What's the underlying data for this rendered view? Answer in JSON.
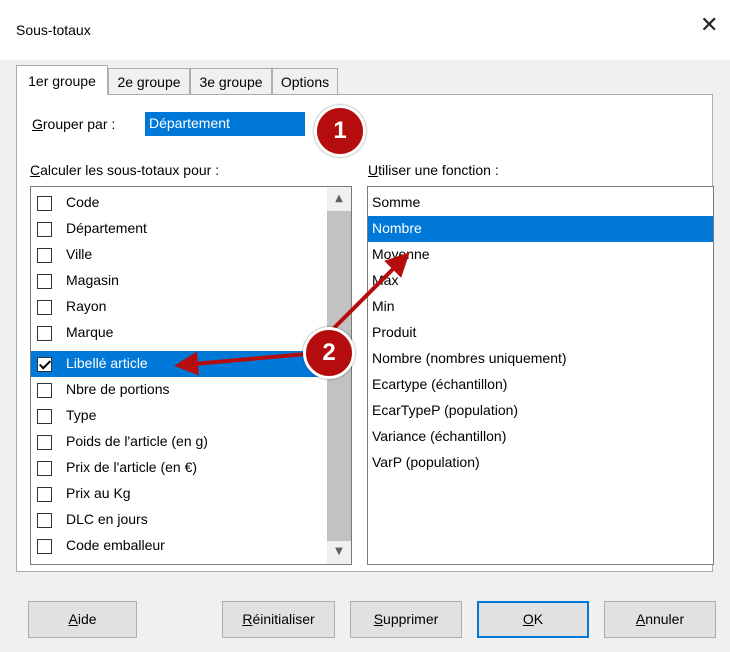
{
  "dialog": {
    "title": "Sous-totaux",
    "close_glyph": "✕"
  },
  "tabs": [
    {
      "label": "1er groupe",
      "active": true
    },
    {
      "label": "2e groupe",
      "active": false
    },
    {
      "label": "3e groupe",
      "active": false
    },
    {
      "label": "Options",
      "active": false
    }
  ],
  "group_by": {
    "label_key": "G",
    "label_rest": "rouper par :",
    "selected_value": "Département"
  },
  "subtotals_for": {
    "label_key": "C",
    "label_rest": "alculer les sous-totaux pour :",
    "items": [
      {
        "label": "Code",
        "checked": false,
        "selected": false
      },
      {
        "label": "Département",
        "checked": false,
        "selected": false
      },
      {
        "label": "Ville",
        "checked": false,
        "selected": false
      },
      {
        "label": "Magasin",
        "checked": false,
        "selected": false
      },
      {
        "label": "Rayon",
        "checked": false,
        "selected": false
      },
      {
        "label": "Marque",
        "checked": false,
        "selected": false
      },
      {
        "label": "Libellé article",
        "checked": true,
        "selected": true
      },
      {
        "label": " Nbre de portions",
        "checked": false,
        "selected": false
      },
      {
        "label": "Type",
        "checked": false,
        "selected": false
      },
      {
        "label": "Poids de l'article (en g)",
        "checked": false,
        "selected": false
      },
      {
        "label": "Prix de l'article (en €)",
        "checked": false,
        "selected": false
      },
      {
        "label": "Prix au Kg",
        "checked": false,
        "selected": false
      },
      {
        "label": "DLC en jours",
        "checked": false,
        "selected": false
      },
      {
        "label": "Code emballeur",
        "checked": false,
        "selected": false
      }
    ]
  },
  "use_function": {
    "label_key": "U",
    "label_rest": "tiliser une fonction :",
    "items": [
      {
        "label": "Somme",
        "selected": false
      },
      {
        "label": "Nombre",
        "selected": true
      },
      {
        "label": "Moyenne",
        "selected": false
      },
      {
        "label": "Max",
        "selected": false
      },
      {
        "label": "Min",
        "selected": false
      },
      {
        "label": "Produit",
        "selected": false
      },
      {
        "label": "Nombre (nombres uniquement)",
        "selected": false
      },
      {
        "label": "Ecartype (échantillon)",
        "selected": false
      },
      {
        "label": "EcarTypeP (population)",
        "selected": false
      },
      {
        "label": "Variance (échantillon)",
        "selected": false
      },
      {
        "label": "VarP (population)",
        "selected": false
      }
    ]
  },
  "scroll": {
    "up_glyph": "▲",
    "down_glyph": "▼"
  },
  "buttons": {
    "help": {
      "key": "A",
      "rest": "ide"
    },
    "reset": {
      "key": "R",
      "rest": "éinitialiser"
    },
    "delete": {
      "key": "S",
      "rest": "upprimer"
    },
    "ok": {
      "key": "O",
      "rest": "K"
    },
    "cancel": {
      "key": "A",
      "rest": "nnuler"
    }
  },
  "annotations": {
    "badge_1": "1",
    "badge_2": "2",
    "color": "#b50d0d"
  },
  "colors": {
    "selection": "#0078d7",
    "background": "#f0f0f0",
    "annotation": "#b50d0d"
  }
}
